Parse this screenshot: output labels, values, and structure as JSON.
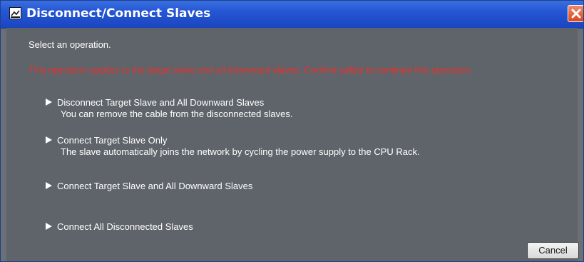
{
  "window": {
    "title": "Disconnect/Connect Slaves",
    "title_bar_color": "#2456d3",
    "close_icon": "close-icon"
  },
  "dialog": {
    "prompt": "Select an operation.",
    "warning": "This operation applies to the target slave and all downward slaves. Confirm safety to continue this operation.",
    "warning_color": "#e8312c"
  },
  "operations": [
    {
      "icon": "play-arrow-icon",
      "label": "Disconnect Target Slave and All Downward Slaves",
      "description": "You can remove the cable from the disconnected slaves."
    },
    {
      "icon": "play-arrow-icon",
      "label": "Connect Target Slave Only",
      "description": "The slave automatically joins the network by cycling the power supply to the CPU Rack."
    },
    {
      "icon": "play-arrow-icon",
      "label": "Connect Target Slave and All Downward Slaves",
      "description": ""
    },
    {
      "icon": "play-arrow-icon",
      "label": "Connect All Disconnected Slaves",
      "description": ""
    }
  ],
  "buttons": {
    "cancel": "Cancel"
  }
}
